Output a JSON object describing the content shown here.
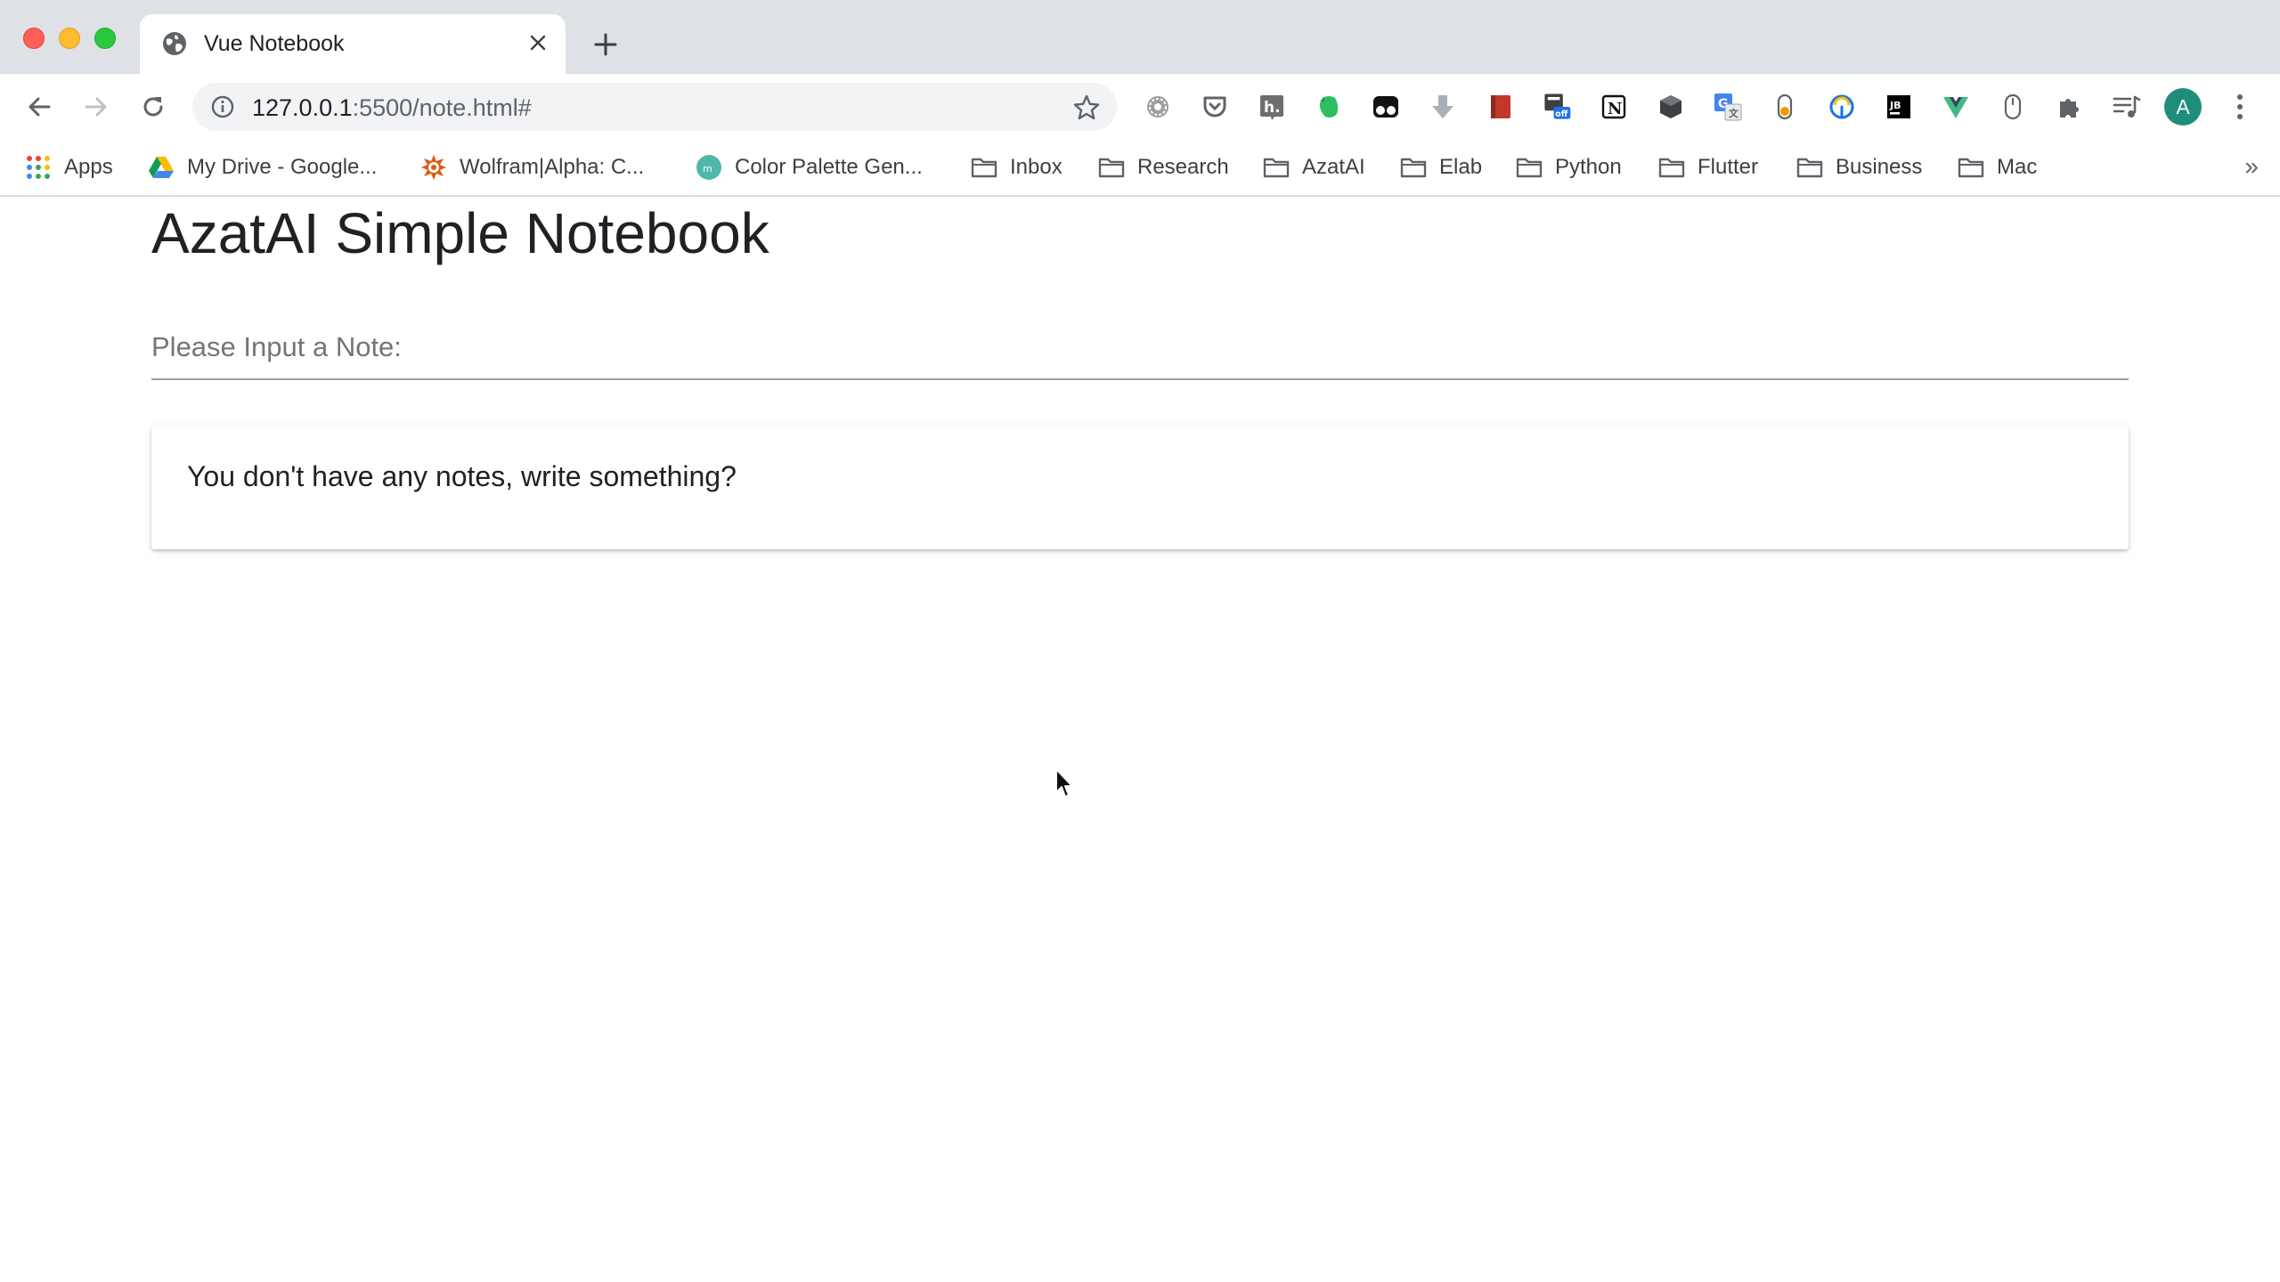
{
  "browser": {
    "tab": {
      "title": "Vue Notebook"
    },
    "address": {
      "host": "127.0.0.1",
      "rest": ":5500/note.html#"
    },
    "avatar_letter": "A",
    "extensions": [
      {
        "name": "gear-extension-icon",
        "glyph": "⚙",
        "color": "#6b6b6b"
      },
      {
        "name": "pocket-extension-icon",
        "glyph": "",
        "color": "#5f6368"
      },
      {
        "name": "hypothesis-extension-icon",
        "glyph": "h.",
        "color": "#5f6368"
      },
      {
        "name": "evernote-extension-icon",
        "glyph": "",
        "color": "#2dbe60"
      },
      {
        "name": "tampermonkey-extension-icon",
        "glyph": "",
        "color": "#111111"
      },
      {
        "name": "download-extension-icon",
        "glyph": "⬇",
        "color": "#9aa0a6"
      },
      {
        "name": "book-extension-icon",
        "glyph": "",
        "color": "#c0392b"
      },
      {
        "name": "off-badge-extension-icon",
        "glyph": "off",
        "color": "#1a73e8"
      },
      {
        "name": "notion-extension-icon",
        "glyph": "N",
        "color": "#111111"
      },
      {
        "name": "cube-extension-icon",
        "glyph": "⬢",
        "color": "#3c4043"
      },
      {
        "name": "translate-extension-icon",
        "glyph": "G",
        "color": "#4285f4"
      },
      {
        "name": "toggle-extension-icon",
        "glyph": "",
        "color": "#f29900"
      },
      {
        "name": "speedometer-extension-icon",
        "glyph": "",
        "color": "#1a73e8"
      },
      {
        "name": "jetbrains-extension-icon",
        "glyph": "JB",
        "color": "#000000"
      },
      {
        "name": "vue-devtools-extension-icon",
        "glyph": "V",
        "color": "#42b883"
      },
      {
        "name": "mouse-extension-icon",
        "glyph": "",
        "color": "#5f6368"
      },
      {
        "name": "puzzle-extensions-icon",
        "glyph": "",
        "color": "#5f6368"
      },
      {
        "name": "media-control-icon",
        "glyph": "",
        "color": "#5f6368"
      }
    ]
  },
  "bookmarks": [
    {
      "label": "Apps",
      "icon": "apps-grid-icon"
    },
    {
      "label": "My Drive - Google...",
      "icon": "google-drive-icon"
    },
    {
      "label": "Wolfram|Alpha: C...",
      "icon": "wolfram-icon"
    },
    {
      "label": "Color Palette Gen...",
      "icon": "color-palette-icon"
    },
    {
      "label": "Inbox",
      "icon": "folder-icon"
    },
    {
      "label": "Research",
      "icon": "folder-icon"
    },
    {
      "label": "AzatAI",
      "icon": "folder-icon"
    },
    {
      "label": "Elab",
      "icon": "folder-icon"
    },
    {
      "label": "Python",
      "icon": "folder-icon"
    },
    {
      "label": "Flutter",
      "icon": "folder-icon"
    },
    {
      "label": "Business",
      "icon": "folder-icon"
    },
    {
      "label": "Mac",
      "icon": "folder-icon"
    }
  ],
  "bookmarks_more": "»",
  "app": {
    "title": "AzatAI Simple Notebook",
    "note_placeholder": "Please Input a Note:",
    "empty_message": "You don't have any notes, write something?"
  }
}
